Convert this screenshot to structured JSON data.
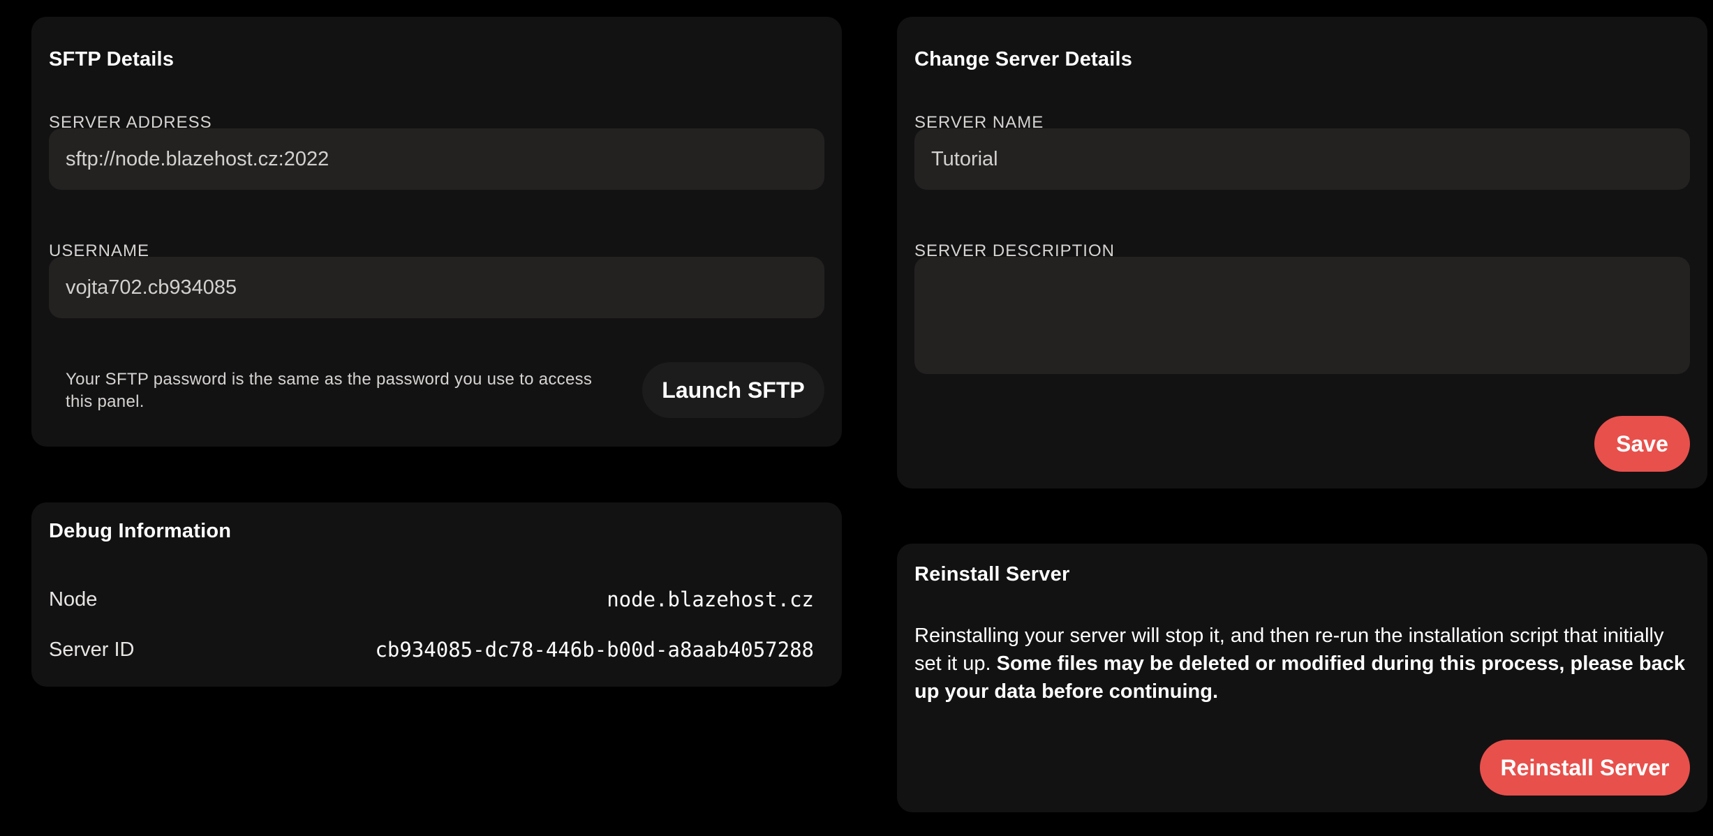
{
  "sftp": {
    "title": "SFTP Details",
    "server_address_label": "Server Address",
    "server_address_value": "sftp://node.blazehost.cz:2022",
    "username_label": "Username",
    "username_value": "vojta702.cb934085",
    "password_note": "Your SFTP password is the same as the password you use to access this panel.",
    "launch_button": "Launch SFTP"
  },
  "debug": {
    "title": "Debug Information",
    "rows": [
      {
        "label": "Node",
        "value": "node.blazehost.cz"
      },
      {
        "label": "Server ID",
        "value": "cb934085-dc78-446b-b00d-a8aab4057288"
      }
    ]
  },
  "change_details": {
    "title": "Change Server Details",
    "server_name_label": "Server Name",
    "server_name_value": "Tutorial",
    "server_description_label": "Server Description",
    "server_description_value": "",
    "save_button": "Save"
  },
  "reinstall": {
    "title": "Reinstall Server",
    "text_normal": "Reinstalling your server will stop it, and then re-run the installation script that initially set it up. ",
    "text_strong": "Some files may be deleted or modified during this process, please back up your data before continuing.",
    "button": "Reinstall Server"
  },
  "colors": {
    "background": "#000000",
    "card": "#131213",
    "input": "#242221",
    "accent_red": "#e8504c",
    "button_dark": "#1d1c1d"
  }
}
